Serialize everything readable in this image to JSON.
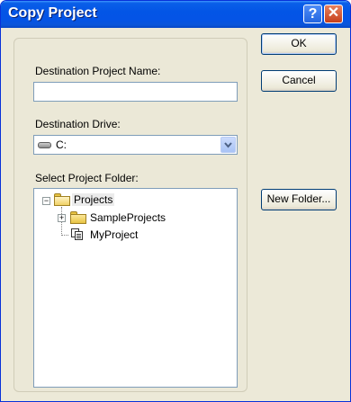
{
  "window": {
    "title": "Copy Project"
  },
  "titlebar_buttons": {
    "help_glyph": "?",
    "close_glyph": "✕"
  },
  "form": {
    "dest_name_label": "Destination Project Name:",
    "dest_name_value": "",
    "drive_label": "Destination Drive:",
    "drive_value": "C:",
    "folder_label": "Select Project Folder:"
  },
  "tree": {
    "root": {
      "label": "Projects",
      "expander": "−",
      "icon": "open-folder-icon"
    },
    "children": [
      {
        "label": "SampleProjects",
        "expander": "+",
        "icon": "folder-icon"
      },
      {
        "label": "MyProject",
        "icon": "project-icon"
      }
    ]
  },
  "buttons": {
    "ok": "OK",
    "cancel": "Cancel",
    "new_folder": "New Folder..."
  },
  "colors": {
    "titlebar": "#0355e6",
    "dialog_bg": "#ece9d8",
    "input_border": "#7f9db9"
  }
}
